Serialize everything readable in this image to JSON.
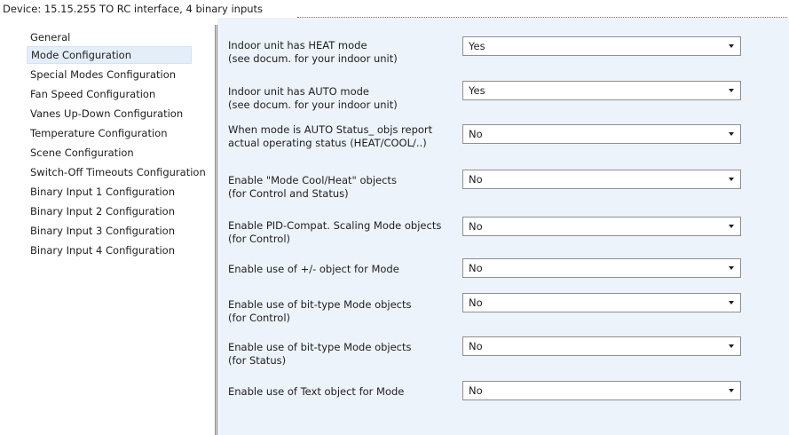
{
  "device_title": "Device: 15.15.255   TO RC interface, 4 binary inputs",
  "sidebar": {
    "items": [
      {
        "label": "General"
      },
      {
        "label": "Mode Configuration"
      },
      {
        "label": "Special Modes Configuration"
      },
      {
        "label": "Fan Speed Configuration"
      },
      {
        "label": "Vanes Up-Down Configuration"
      },
      {
        "label": "Temperature Configuration"
      },
      {
        "label": "Scene Configuration"
      },
      {
        "label": "Switch-Off Timeouts Configuration"
      },
      {
        "label": "Binary Input 1 Configuration"
      },
      {
        "label": "Binary Input 2 Configuration"
      },
      {
        "label": "Binary Input 3 Configuration"
      },
      {
        "label": "Binary Input 4 Configuration"
      }
    ],
    "selected_index": 1
  },
  "params": [
    {
      "line1": "Indoor unit has HEAT mode",
      "line2": "(see docum. for your indoor unit)",
      "value": "Yes"
    },
    {
      "line1": "Indoor unit has AUTO mode",
      "line2": "(see docum. for your indoor unit)",
      "value": "Yes"
    },
    {
      "line1": "When mode is AUTO Status_ objs report",
      "line2": "actual operating status (HEAT/COOL/..)",
      "value": "No"
    },
    {
      "line1": "Enable \"Mode Cool/Heat\" objects",
      "line2": "(for Control and Status)",
      "value": "No"
    },
    {
      "line1": "Enable PID-Compat. Scaling Mode objects",
      "line2": "(for Control)",
      "value": "No"
    },
    {
      "line1": "Enable use of +/- object for Mode",
      "line2": "",
      "value": "No"
    },
    {
      "line1": "Enable use of bit-type Mode objects",
      "line2": "(for Control)",
      "value": "No"
    },
    {
      "line1": "Enable use of bit-type Mode objects",
      "line2": "(for Status)",
      "value": "No"
    },
    {
      "line1": "Enable use of Text object for Mode",
      "line2": "",
      "value": "No"
    }
  ]
}
